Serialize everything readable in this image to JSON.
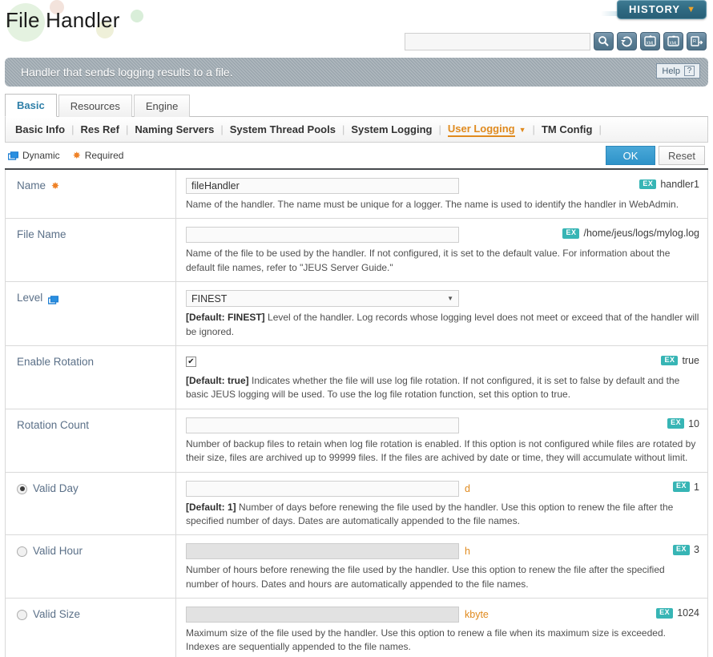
{
  "header": {
    "title": "File Handler",
    "history_label": "HISTORY",
    "history_caret": "▼",
    "search_value": "",
    "search_placeholder": "",
    "toolbar_buttons": [
      {
        "name": "search-icon",
        "label": "Search"
      },
      {
        "name": "refresh-icon",
        "label": "Refresh"
      },
      {
        "name": "xml-upload-icon",
        "label": "XML Upload"
      },
      {
        "name": "xml-download-icon",
        "label": "XML Download"
      },
      {
        "name": "resource-icon",
        "label": "Resource"
      }
    ]
  },
  "banner": {
    "text": "Handler that sends logging results to a file.",
    "help_label": "Help",
    "help_icon": "?"
  },
  "tabs": [
    {
      "label": "Basic",
      "active": true
    },
    {
      "label": "Resources",
      "active": false
    },
    {
      "label": "Engine",
      "active": false
    }
  ],
  "subnav": [
    {
      "label": "Basic Info",
      "current": false,
      "caret": false
    },
    {
      "label": "Res Ref",
      "current": false,
      "caret": false
    },
    {
      "label": "Naming Servers",
      "current": false,
      "caret": false
    },
    {
      "label": "System Thread Pools",
      "current": false,
      "caret": false
    },
    {
      "label": "System Logging",
      "current": false,
      "caret": false
    },
    {
      "label": "User Logging",
      "current": true,
      "caret": true
    },
    {
      "label": "TM Config",
      "current": false,
      "caret": false
    }
  ],
  "legend": {
    "dynamic_label": "Dynamic",
    "required_label": "Required",
    "ok_label": "OK",
    "reset_label": "Reset"
  },
  "colors": {
    "accent_orange": "#e08a1e",
    "accent_blue": "#2e7fa8",
    "ex_badge_teal": "#37b5b5",
    "label_slate": "#5b7088",
    "ok_button": "#2e93c9"
  },
  "rows": [
    {
      "label": "Name",
      "marker": "required",
      "control": "text",
      "value": "fileHandler",
      "unit": "",
      "ex_label": "EX",
      "ex_value": "handler1",
      "default_text": "",
      "description": "Name of the handler. The name must be unique for a logger. The name is used to identify the handler in WebAdmin."
    },
    {
      "label": "File Name",
      "marker": "none",
      "control": "text",
      "value": "",
      "unit": "",
      "ex_label": "EX",
      "ex_value": "/home/jeus/logs/mylog.log",
      "default_text": "",
      "description": "Name of the file to be used by the handler. If not configured, it is set to the default value. For information about the default file names, refer to \"JEUS Server Guide.\""
    },
    {
      "label": "Level",
      "marker": "dynamic",
      "control": "select",
      "value": "FINEST",
      "unit": "",
      "ex_label": "",
      "ex_value": "",
      "default_text": "[Default: FINEST]",
      "description": "Level of the handler. Log records whose logging level does not meet or exceed that of the handler will be ignored."
    },
    {
      "label": "Enable Rotation",
      "marker": "none",
      "control": "checkbox",
      "value": "checked",
      "unit": "",
      "ex_label": "EX",
      "ex_value": "true",
      "default_text": "[Default: true]",
      "description": "Indicates whether the file will use log file rotation. If not configured, it is set to false by default and the basic JEUS logging will be used. To use the log file rotation function, set this option to true."
    },
    {
      "label": "Rotation Count",
      "marker": "none",
      "control": "text",
      "value": "",
      "unit": "",
      "ex_label": "EX",
      "ex_value": "10",
      "default_text": "",
      "description": "Number of backup files to retain when log file rotation is enabled. If this option is not configured while files are rotated by their size, files are archived up to 99999 files. If the files are achived by date or time, they will accumulate without limit."
    },
    {
      "label": "Valid Day",
      "marker": "radio-on",
      "control": "text",
      "value": "",
      "unit": "d",
      "ex_label": "EX",
      "ex_value": "1",
      "default_text": "[Default: 1]",
      "description": "Number of days before renewing the file used by the handler. Use this option to renew the file after the specified number of days. Dates are automatically appended to the file names."
    },
    {
      "label": "Valid Hour",
      "marker": "radio-off",
      "control": "text-disabled",
      "value": "",
      "unit": "h",
      "ex_label": "EX",
      "ex_value": "3",
      "default_text": "",
      "description": "Number of hours before renewing the file used by the handler. Use this option to renew the file after the specified number of hours. Dates and hours are automatically appended to the file names."
    },
    {
      "label": "Valid Size",
      "marker": "radio-off",
      "control": "text-disabled",
      "value": "",
      "unit": "kbyte",
      "ex_label": "EX",
      "ex_value": "1024",
      "default_text": "",
      "description": "Maximum size of the file used by the handler. Use this option to renew a file when its maximum size is exceeded. Indexes are sequentially appended to the file names."
    }
  ]
}
